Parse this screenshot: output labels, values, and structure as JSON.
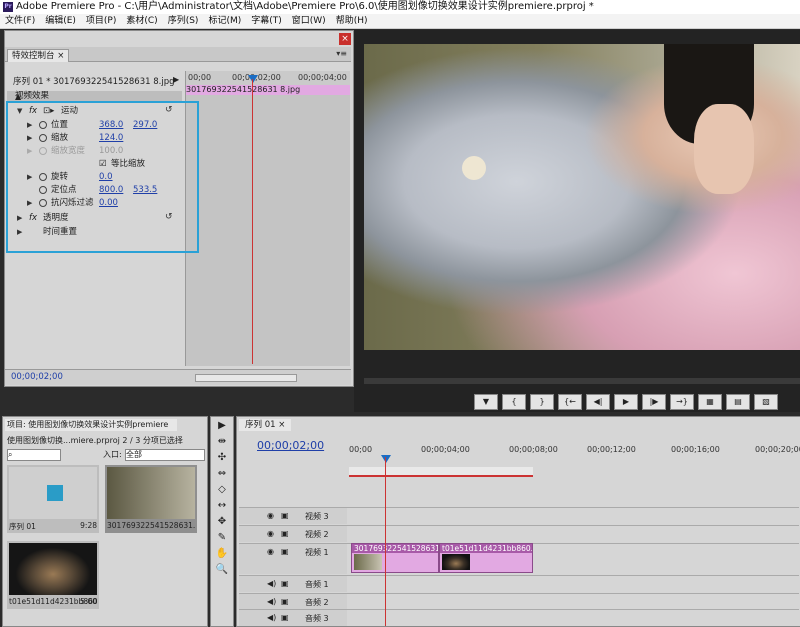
{
  "titlebar": {
    "logo": "Pr",
    "title": "Adobe Premiere Pro - C:\\用户\\Administrator\\文档\\Adobe\\Premiere Pro\\6.0\\使用图划像切换效果设计实例premiere.prproj *"
  },
  "menu": [
    "文件(F)",
    "编辑(E)",
    "项目(P)",
    "素材(C)",
    "序列(S)",
    "标记(M)",
    "字幕(T)",
    "窗口(W)",
    "帮助(H)"
  ],
  "effect_controls": {
    "tab": "特效控制台",
    "tab_close": "×",
    "menu_icon": "▾≡",
    "close": "×",
    "sequence": "序列 01 * 301769322541528631 8.jpg",
    "video_effects": "视频效果",
    "motion": "运动",
    "rows": [
      {
        "label": "位置",
        "v1": "368.0",
        "v2": "297.0"
      },
      {
        "label": "缩放",
        "v1": "124.0"
      },
      {
        "label": "缩放宽度",
        "v1": "100.0"
      },
      {
        "label": "等比缩放"
      },
      {
        "label": "旋转",
        "v1": "0.0"
      },
      {
        "label": "定位点",
        "v1": "800.0",
        "v2": "533.5"
      },
      {
        "label": "抗闪烁过滤",
        "v1": "0.00"
      }
    ],
    "opacity": "透明度",
    "time_remap": "时间重置",
    "ruler": [
      "00;00",
      "00;00;02;00",
      "00;00;04;00"
    ],
    "clip": "301769322541528631 8.jpg",
    "timecode": "00;00;02;00"
  },
  "monitor_controls": [
    "▼",
    "{",
    "}",
    "{←",
    "◀|",
    "▶",
    "|▶",
    "→}",
    "▦",
    "▤",
    "▧"
  ],
  "project": {
    "tab": "项目: 使用图划像切换效果设计实例premiere",
    "info": "使用图划像切换...miere.prproj    2 / 3 分项已选择",
    "in_label": "入口:",
    "select": "全部",
    "items": [
      {
        "name": "序列 01",
        "dur": "9:28"
      },
      {
        "name": "301769322541528631...",
        "dur": ""
      },
      {
        "name": "t01e51d11d4231bb860...",
        "dur": "5:00"
      }
    ]
  },
  "tools": [
    "▶",
    "⇹",
    "✣",
    "⇔",
    "◇",
    "↔",
    "✥",
    "✎",
    "✋",
    "🔍"
  ],
  "timeline": {
    "tab": "序列 01",
    "tab_close": "×",
    "timecode": "00;00;02;00",
    "ruler": [
      "00;00",
      "00;00;04;00",
      "00;00;08;00",
      "00;00;12;00",
      "00;00;16;00",
      "00;00;20;00"
    ],
    "tracks": [
      "视频 3",
      "视频 2",
      "视频 1",
      "音频 1",
      "音频 2",
      "音频 3"
    ],
    "clip1": "301769322541528631 8.jpg",
    "clip2": "t01e51d11d4231bb860.jpg"
  }
}
